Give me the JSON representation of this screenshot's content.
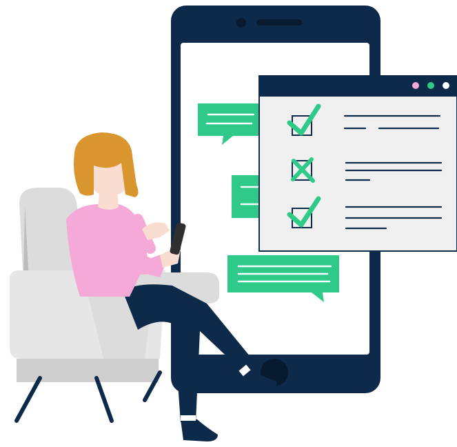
{
  "colors": {
    "navy": "#0e2a4a",
    "screen": "#ffffff",
    "panel": "#f0f0f0",
    "green": "#2fc98a",
    "pink": "#f5a9d8",
    "hair": "#d9952e",
    "skin": "#f9ddd0",
    "chair": "#dcdcdc",
    "chair_shade": "#bdbdbd",
    "window_dots": [
      "#f5a9d8",
      "#2fc98a",
      "#ffffff"
    ]
  },
  "checklist": {
    "items": [
      {
        "mark": "check",
        "state": "done"
      },
      {
        "mark": "cross",
        "state": "rejected"
      },
      {
        "mark": "check",
        "state": "done"
      }
    ]
  },
  "icons": [
    "check-icon",
    "cross-icon",
    "phone-speaker-icon",
    "window-dot-icon"
  ]
}
